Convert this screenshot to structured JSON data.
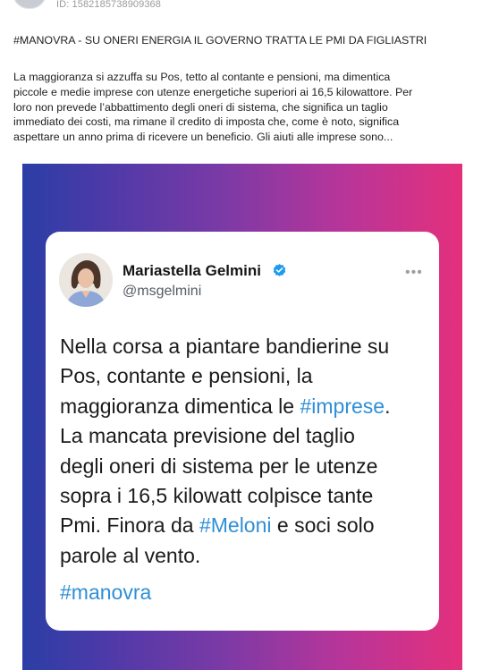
{
  "post": {
    "id_text": "ID: 1582185738909368",
    "title": "#MANOVRA - SU ONERI ENERGIA IL GOVERNO TRATTA LE PMI DA FIGLIASTRI",
    "body_lines": [
      "La maggioranza si azzuffa su Pos, tetto al contante e pensioni, ma dimentica",
      "piccole e medie imprese con utenze energetiche superiori ai 16,5 kilowattore. Per",
      "loro non prevede l’abbattimento degli oneri di sistema, che significa un taglio",
      "immediato dei costi, ma rimane il credito di imposta che, come è noto, significa",
      "aspettare un anno prima di ricevere un beneficio. Gli aiuti alle imprese sono..."
    ]
  },
  "tweet": {
    "name": "Mariastella Gelmini",
    "handle": "@msgelmini",
    "more": "•••",
    "lines": [
      {
        "pre": "Nella corsa a piantare bandierine su",
        "tag": "",
        "post": ""
      },
      {
        "pre": "Pos, contante e pensioni, la",
        "tag": "",
        "post": ""
      },
      {
        "pre": "maggioranza dimentica le ",
        "tag": "#imprese",
        "post": "."
      },
      {
        "pre": "La mancata previsione del taglio",
        "tag": "",
        "post": ""
      },
      {
        "pre": "degli oneri di sistema per le utenze",
        "tag": "",
        "post": ""
      },
      {
        "pre": "sopra i 16,5 kilowatt colpisce tante",
        "tag": "",
        "post": ""
      },
      {
        "pre": "Pmi. Finora da ",
        "tag": "#Meloni",
        "post": " e soci solo"
      },
      {
        "pre": "parole al vento.",
        "tag": "",
        "post": ""
      }
    ],
    "hashtag_footer": "#manovra"
  },
  "colors": {
    "hashtag": "#2f8fd6",
    "verified": "#1d9bf0",
    "gradient_left": "#2b3ea6",
    "gradient_right": "#e4307c"
  },
  "icons": {
    "verified": "verified-badge-icon",
    "more": "more-options-icon"
  }
}
